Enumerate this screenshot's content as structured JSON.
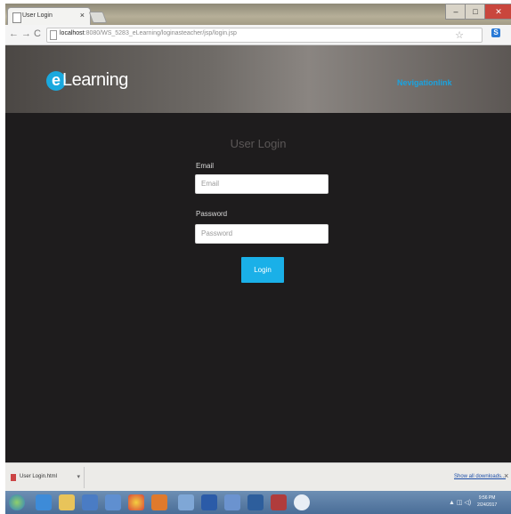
{
  "browser": {
    "tab_title": "User Login",
    "tab_close": "×",
    "url_host": "localhost",
    "url_path": ":8080/WS_5283_eLearning/loginasteacher/jsp/login.jsp",
    "nav_back": "←",
    "nav_forward": "→",
    "nav_reload": "C",
    "star": "☆",
    "ext_label": "S",
    "win_min": "–",
    "win_max": "□",
    "win_close": "✕"
  },
  "header": {
    "logo_letter": "e",
    "logo_text": "Learning",
    "nav_link": "Nevigationlink"
  },
  "form": {
    "title": "User Login",
    "email_label": "Email",
    "email_placeholder": "Email",
    "password_label": "Password",
    "password_placeholder": "Password",
    "login_label": "Login"
  },
  "downloads": {
    "file_name": "User Login.html",
    "arrow": "▾",
    "show_all": "Show all downloads...",
    "close": "×"
  },
  "taskbar": {
    "clock_time": "9:56 PM",
    "clock_date": "2/24/2017",
    "tray_flags": "▲ ◫ ◁)"
  }
}
